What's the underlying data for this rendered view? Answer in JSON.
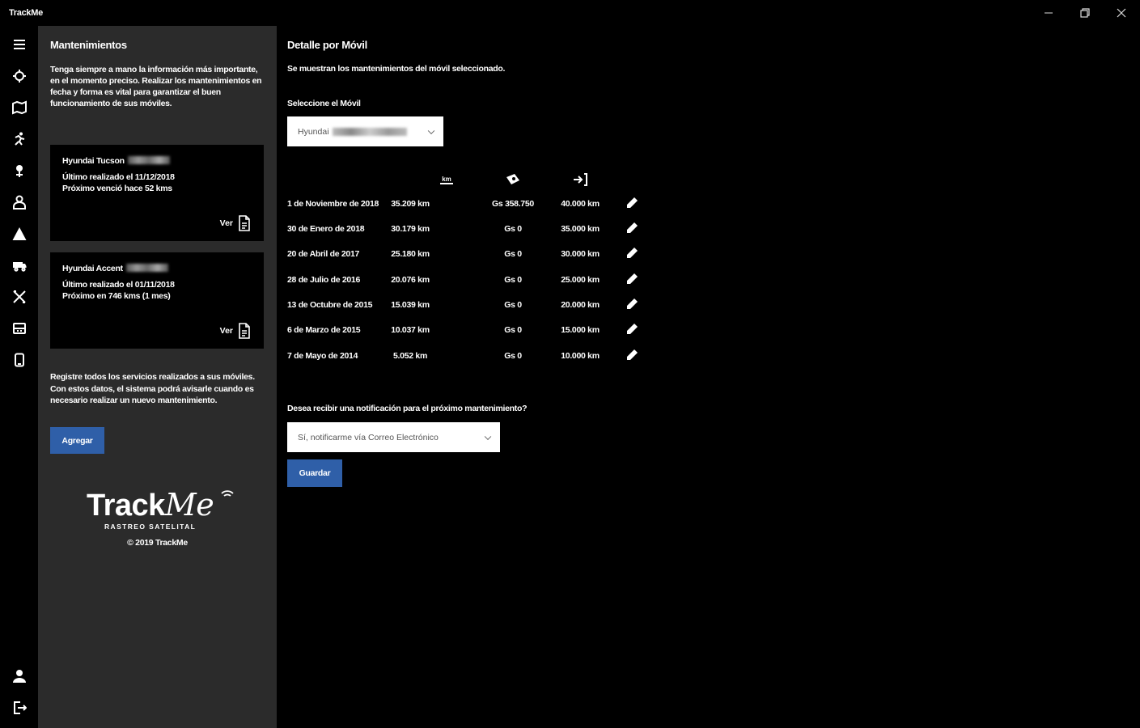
{
  "window": {
    "title": "TrackMe"
  },
  "sidebar": {
    "icons": [
      "menu-icon",
      "target-icon",
      "map-icon",
      "running-icon",
      "pin-icon",
      "driver-icon",
      "alert-icon",
      "truck-icon",
      "tools-icon",
      "car-icon",
      "phone-icon"
    ],
    "bottom_icons": [
      "user-icon",
      "logout-icon"
    ]
  },
  "panel": {
    "title": "Mantenimientos",
    "intro": "Tenga siempre a mano la información más importante, en el momento preciso. Realizar los mantenimientos en fecha y forma es vital para garantizar el buen funcionamiento de sus móviles.",
    "cards": [
      {
        "title": "Hyundai Tucson",
        "line1": "Último realizado el 11/12/2018",
        "line2": "Próximo venció hace 52 kms",
        "ver": "Ver"
      },
      {
        "title": "Hyundai Accent",
        "line1": "Último realizado el 01/11/2018",
        "line2": "Próximo en 746 kms (1 mes)",
        "ver": "Ver"
      }
    ],
    "register_text": "Registre todos los servicios realizados a sus móviles. Con estos datos, el sistema podrá avisarle cuando es necesario realizar un nuevo mantenimiento.",
    "add_button": "Agregar",
    "logo_track": "Track",
    "logo_me": "Me",
    "logo_sub": "RASTREO SATELITAL",
    "copyright": "© 2019 TrackMe"
  },
  "main": {
    "title": "Detalle por Móvil",
    "subtitle": "Se muestran los mantenimientos del móvil seleccionado.",
    "select_label": "Seleccione el Móvil",
    "select_value": "Hyundai",
    "columns": [
      "km-icon",
      "money-icon",
      "next-icon"
    ],
    "rows": [
      {
        "date": "1 de Noviembre de 2018",
        "km": "35.209 km",
        "cost": "Gs 358.750",
        "next": "40.000 km"
      },
      {
        "date": "30 de Enero de 2018",
        "km": "30.179 km",
        "cost": "Gs 0",
        "next": "35.000 km"
      },
      {
        "date": "20 de Abril de 2017",
        "km": "25.180 km",
        "cost": "Gs 0",
        "next": "30.000 km"
      },
      {
        "date": "28 de Julio de 2016",
        "km": "20.076 km",
        "cost": "Gs 0",
        "next": "25.000 km"
      },
      {
        "date": "13 de Octubre de 2015",
        "km": "15.039 km",
        "cost": "Gs 0",
        "next": "20.000 km"
      },
      {
        "date": "6 de Marzo de 2015",
        "km": "10.037 km",
        "cost": "Gs 0",
        "next": "15.000 km"
      },
      {
        "date": "7 de Mayo de 2014",
        "km": "5.052 km",
        "cost": "Gs 0",
        "next": "10.000 km"
      }
    ],
    "notif_label": "Desea recibir una notificación para el próximo mantenimiento?",
    "notif_value": "Sí, notificarme vía Correo Electrónico",
    "save_button": "Guardar"
  }
}
